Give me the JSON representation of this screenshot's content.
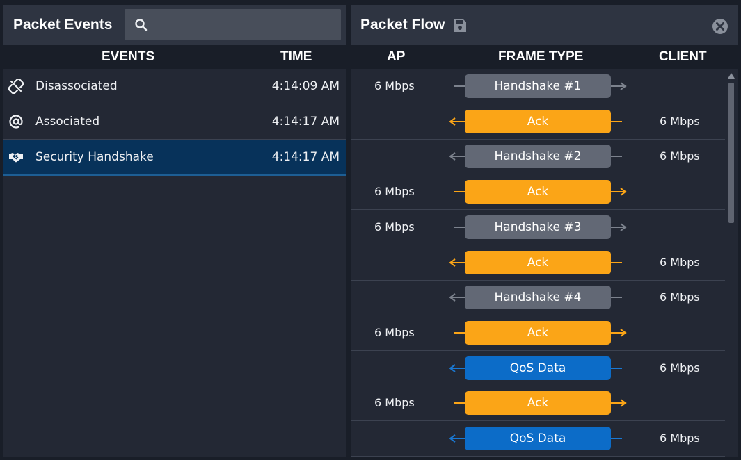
{
  "left": {
    "title": "Packet Events",
    "search": {
      "value": "",
      "placeholder": ""
    },
    "columns": {
      "events": "EVENTS",
      "time": "TIME"
    },
    "events": [
      {
        "icon": "unlink-icon",
        "name": "Disassociated",
        "time": "4:14:09 AM",
        "selected": false
      },
      {
        "icon": "at-sign-icon",
        "name": "Associated",
        "time": "4:14:17 AM",
        "selected": false
      },
      {
        "icon": "handshake-icon",
        "name": "Security Handshake",
        "time": "4:14:17 AM",
        "selected": true
      }
    ]
  },
  "right": {
    "title": "Packet Flow",
    "save_icon": "save-icon",
    "close_icon": "close-icon",
    "columns": {
      "ap": "AP",
      "frame_type": "FRAME TYPE",
      "client": "CLIENT"
    },
    "frames": [
      {
        "ap": "6 Mbps",
        "frame": "Handshake #1",
        "client": "",
        "kind": "handshake",
        "direction": "to-client"
      },
      {
        "ap": "",
        "frame": "Ack",
        "client": "6 Mbps",
        "kind": "ack",
        "direction": "to-ap"
      },
      {
        "ap": "",
        "frame": "Handshake #2",
        "client": "6 Mbps",
        "kind": "handshake",
        "direction": "to-ap"
      },
      {
        "ap": "6 Mbps",
        "frame": "Ack",
        "client": "",
        "kind": "ack",
        "direction": "to-client"
      },
      {
        "ap": "6 Mbps",
        "frame": "Handshake #3",
        "client": "",
        "kind": "handshake",
        "direction": "to-client"
      },
      {
        "ap": "",
        "frame": "Ack",
        "client": "6 Mbps",
        "kind": "ack",
        "direction": "to-ap"
      },
      {
        "ap": "",
        "frame": "Handshake #4",
        "client": "6 Mbps",
        "kind": "handshake",
        "direction": "to-ap"
      },
      {
        "ap": "6 Mbps",
        "frame": "Ack",
        "client": "",
        "kind": "ack",
        "direction": "to-client"
      },
      {
        "ap": "",
        "frame": "QoS Data",
        "client": "6 Mbps",
        "kind": "qos",
        "direction": "to-ap"
      },
      {
        "ap": "6 Mbps",
        "frame": "Ack",
        "client": "",
        "kind": "ack",
        "direction": "to-client"
      },
      {
        "ap": "",
        "frame": "QoS Data",
        "client": "6 Mbps",
        "kind": "qos",
        "direction": "to-ap"
      }
    ]
  },
  "colors": {
    "handshake": "#626875",
    "ack": "#fba517",
    "qos": "#0c6cc8",
    "selected_row": "#07325a",
    "handshake_arrow": "#7c828d",
    "ack_arrow": "#fba517",
    "qos_arrow": "#1a78d2"
  }
}
